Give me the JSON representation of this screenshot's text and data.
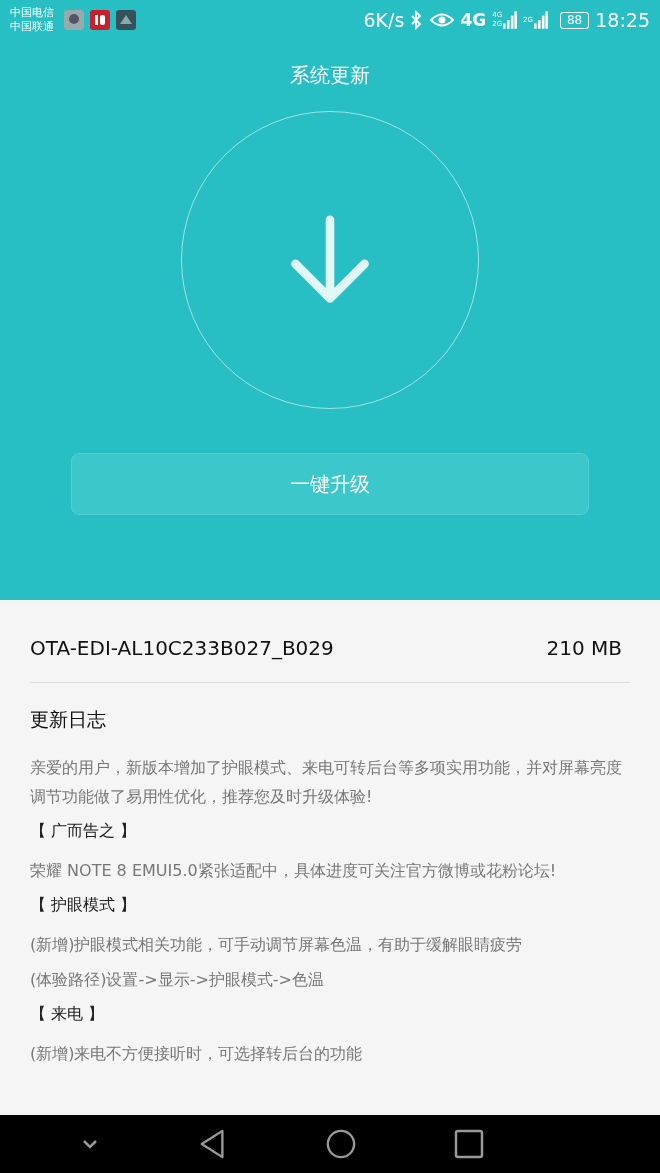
{
  "status_bar": {
    "carriers": [
      "中国电信",
      "中国联通"
    ],
    "speed": "6K/s",
    "network": "4G",
    "signals": [
      {
        "label": "4G",
        "sub": "2G"
      },
      {
        "label": "2G"
      }
    ],
    "battery": "88",
    "time": "18:25"
  },
  "title": "系统更新",
  "upgrade_button": "一键升级",
  "package": {
    "name": "OTA-EDI-AL10C233B027_B029",
    "size": "210 MB"
  },
  "changelog": {
    "title": "更新日志",
    "items": [
      {
        "kind": "paragraph",
        "text": "亲爱的用户，新版本增加了护眼模式、来电可转后台等多项实用功能，并对屏幕亮度调节功能做了易用性优化，推荐您及时升级体验!"
      },
      {
        "kind": "heading",
        "text": "【 广而告之 】"
      },
      {
        "kind": "paragraph",
        "text": "荣耀 NOTE 8 EMUI5.0紧张适配中，具体进度可关注官方微博或花粉论坛!"
      },
      {
        "kind": "heading",
        "text": "【 护眼模式 】"
      },
      {
        "kind": "paragraph",
        "text": "(新增)护眼模式相关功能，可手动调节屏幕色温，有助于缓解眼睛疲劳"
      },
      {
        "kind": "paragraph",
        "text": "(体验路径)设置->显示->护眼模式->色温"
      },
      {
        "kind": "heading",
        "text": "【 来电 】"
      },
      {
        "kind": "paragraph",
        "text": "(新增)来电不方便接听时，可选择转后台的功能"
      }
    ]
  }
}
